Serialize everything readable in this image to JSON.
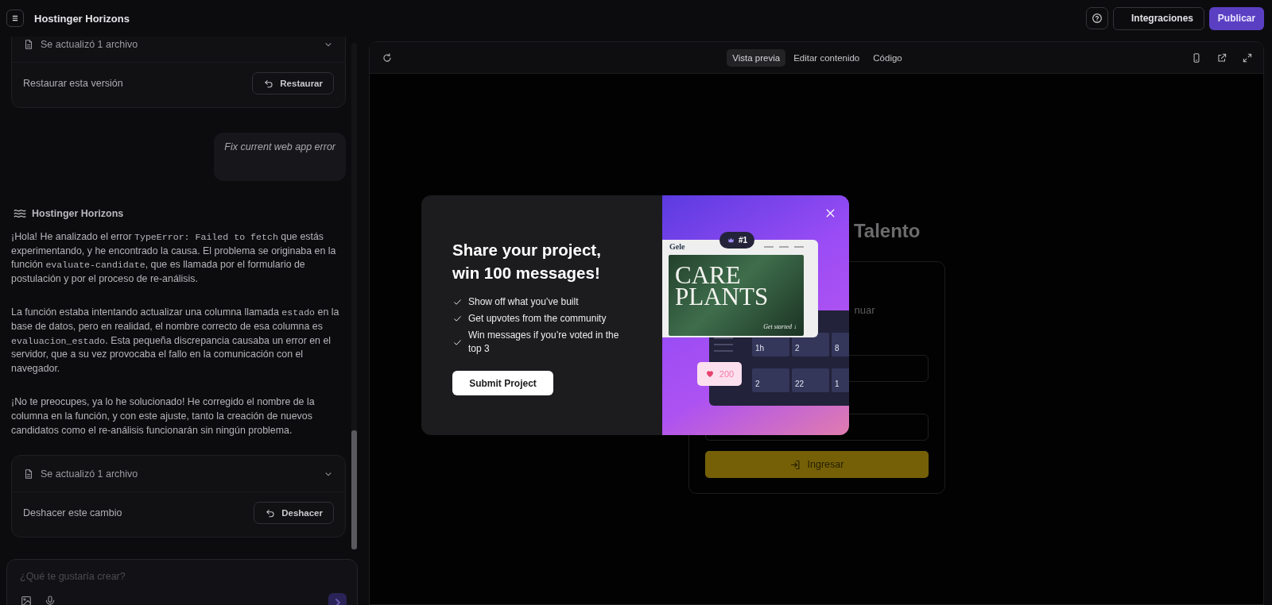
{
  "topbar": {
    "title": "Hostinger Horizons",
    "actions": [
      {
        "label": "Integraciones",
        "kind": "secondary"
      },
      {
        "label": "Publicar",
        "kind": "primary"
      }
    ]
  },
  "chat": {
    "messages": [
      {
        "kind": "change_card",
        "file_label": "Se actualizó 1 archivo",
        "action_text": "Restaurar esta versión",
        "button": "Restaurar"
      },
      {
        "kind": "user",
        "text": "Fix current web app error"
      },
      {
        "kind": "assistant",
        "author": "Hostinger Horizons",
        "paragraphs": [
          [
            {
              "kind": "text",
              "text": "¡Hola! He analizado el error "
            },
            {
              "kind": "code",
              "text": "TypeError: Failed to fetch"
            },
            {
              "kind": "text",
              "text": " que estás experimentando, y he encontrado la causa. El problema se originaba en la función "
            },
            {
              "kind": "code",
              "text": "evaluate-candidate"
            },
            {
              "kind": "text",
              "text": ", que es llamada por el formulario de postulación y por el proceso de re-análisis."
            }
          ],
          [
            {
              "kind": "text",
              "text": "La función estaba intentando actualizar una columna llamada "
            },
            {
              "kind": "code",
              "text": "estado"
            },
            {
              "kind": "text",
              "text": " en la base de datos, pero en realidad, el nombre correcto de esa columna es "
            },
            {
              "kind": "code",
              "text": "evaluacion_estado"
            },
            {
              "kind": "text",
              "text": ". Esta pequeña discrepancia causaba un error en el servidor, que a su vez provocaba el fallo en la comunicación con el navegador."
            }
          ],
          [
            {
              "kind": "text",
              "text": "¡No te preocupes, ya lo he solucionado! He corregido el nombre de la columna en la función, y con este ajuste, tanto la creación de nuevos candidatos como el re-análisis funcionarán sin ningún problema."
            }
          ]
        ]
      },
      {
        "kind": "change_card",
        "file_label": "Se actualizó 1 archivo",
        "action_text": "Deshacer este cambio",
        "button": "Deshacer"
      }
    ]
  },
  "composer": {
    "placeholder": "¿Qué te gustaría crear?"
  },
  "preview": {
    "tabs": [
      {
        "label": "Vista previa",
        "selected": true
      },
      {
        "label": "Editar contenido",
        "selected": false
      },
      {
        "label": "Código",
        "selected": false
      }
    ],
    "page": {
      "title": "Talento",
      "text": "nuar",
      "button": "Ingresar"
    }
  },
  "modal": {
    "title": "Share your project, win 100 messages!",
    "benefits": [
      "Show off what you’ve built",
      "Get upvotes from the community",
      "Win messages if you’re voted in the top 3"
    ],
    "button": "Submit Project",
    "promo": {
      "badge": "#1",
      "site_logo": "Gele",
      "hero_lines": [
        "CARE",
        "PLANTS"
      ],
      "hero_cta": "Get started ↓",
      "likes": "200",
      "stats": [
        "1h",
        "2",
        "8",
        "2",
        "22",
        "1"
      ]
    }
  }
}
